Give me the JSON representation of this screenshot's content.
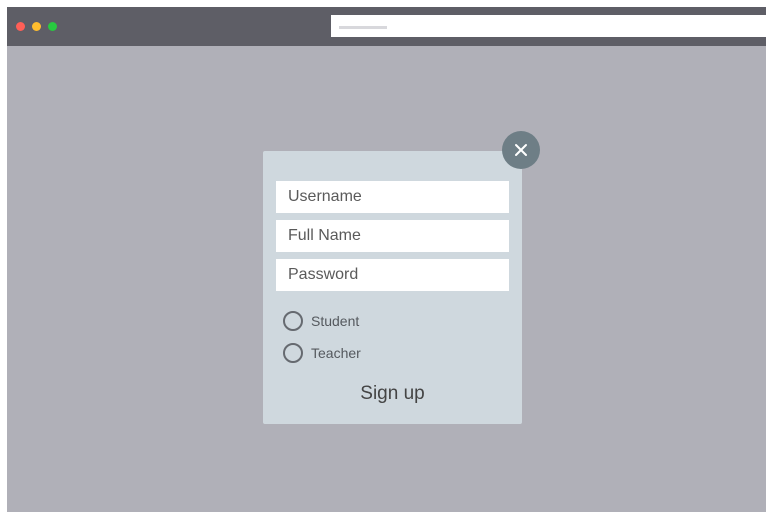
{
  "browser": {
    "window_controls": [
      "close-dot",
      "minimize-dot",
      "maximize-dot"
    ],
    "colors": {
      "close": "#ff5f57",
      "minimize": "#ffbd2e",
      "maximize": "#28c940"
    }
  },
  "modal": {
    "close_icon": "×",
    "fields": {
      "username_placeholder": "Username",
      "fullname_placeholder": "Full Name",
      "password_placeholder": "Password"
    },
    "roles": [
      {
        "label": "Student"
      },
      {
        "label": "Teacher"
      }
    ],
    "submit_label": "Sign up"
  }
}
